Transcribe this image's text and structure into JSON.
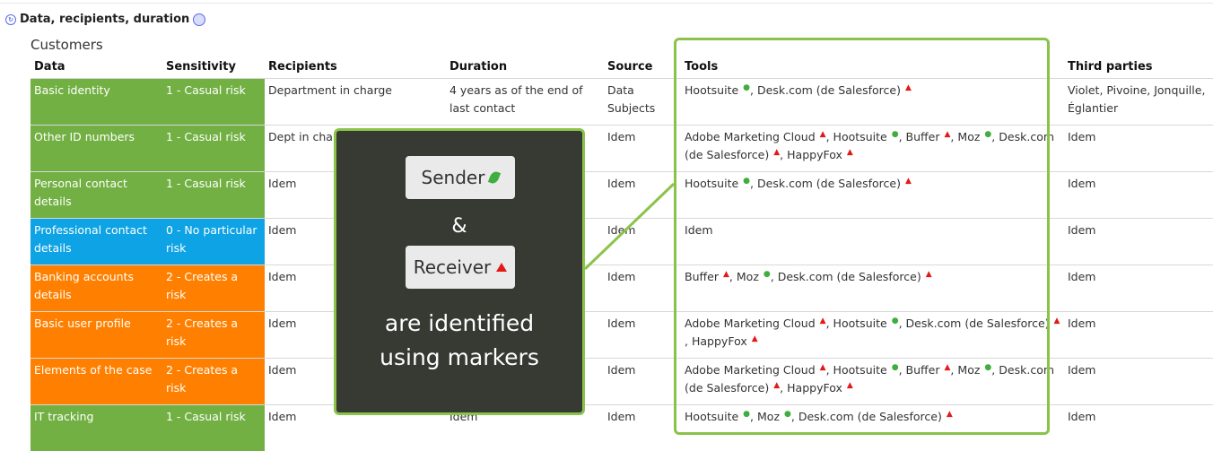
{
  "header": {
    "title": "Data, recipients, duration"
  },
  "group": {
    "title": "Customers"
  },
  "columns": {
    "data": "Data",
    "sensitivity": "Sensitivity",
    "recipients": "Recipients",
    "duration": "Duration",
    "source": "Source",
    "tools": "Tools",
    "third_parties": "Third parties"
  },
  "rows": [
    {
      "data": "Basic identity",
      "sensitivity": "1 - Casual risk",
      "recipients": "Department in charge",
      "duration": "4 years as of the end of last contact",
      "source": "Data Subjects",
      "tools": "Hootsuite ●, Desk.com (de Salesforce) ▲",
      "third_parties": "Violet, Pivoine, Jonquille, Églantier",
      "color": "#72b043"
    },
    {
      "data": "Other ID numbers",
      "sensitivity": "1 - Casual risk",
      "recipients": "Dept in charge, authorized ...",
      "duration": "",
      "source": "Idem",
      "tools": "Adobe Marketing Cloud ▲, Hootsuite ●, Buffer ▲, Moz ●, Desk.com (de Salesforce) ▲, HappyFox ▲",
      "third_parties": "Idem",
      "color": "#72b043"
    },
    {
      "data": "Personal contact details",
      "sensitivity": "1 - Casual risk",
      "recipients": "Idem",
      "duration": "",
      "source": "Idem",
      "tools": "Hootsuite ●, Desk.com (de Salesforce) ▲",
      "third_parties": "Idem",
      "color": "#72b043"
    },
    {
      "data": "Professional contact details",
      "sensitivity": "0 - No particular risk",
      "recipients": "Idem",
      "duration": "",
      "source": "Idem",
      "tools": "Idem",
      "third_parties": "Idem",
      "color": "#0ea3e4"
    },
    {
      "data": "Banking accounts details",
      "sensitivity": "2 - Creates a risk",
      "recipients": "Idem",
      "duration": "",
      "source": "Idem",
      "tools": "Buffer ▲, Moz ●, Desk.com (de Salesforce) ▲",
      "third_parties": "Idem",
      "color": "#ff8000"
    },
    {
      "data": "Basic user profile",
      "sensitivity": "2 - Creates a risk",
      "recipients": "Idem",
      "duration": "",
      "source": "Idem",
      "tools": "Adobe Marketing Cloud ▲, Hootsuite ●, Desk.com (de Salesforce) ▲, HappyFox ▲",
      "third_parties": "Idem",
      "color": "#ff8000"
    },
    {
      "data": "Elements of the case",
      "sensitivity": "2 - Creates a risk",
      "recipients": "Idem",
      "duration": "",
      "source": "Idem",
      "tools": "Adobe Marketing Cloud ▲, Hootsuite ●, Buffer ▲, Moz ●, Desk.com (de Salesforce) ▲, HappyFox ▲",
      "third_parties": "Idem",
      "color": "#ff8000"
    },
    {
      "data": "IT tracking",
      "sensitivity": "1 - Casual risk",
      "recipients": "Idem",
      "duration": "Idem",
      "source": "Idem",
      "tools": "Hootsuite ●, Moz ●, Desk.com (de Salesforce) ▲",
      "third_parties": "Idem",
      "color": "#72b043"
    }
  ],
  "overlay": {
    "sender_label": "Sender",
    "amp": "&",
    "receiver_label": "Receiver",
    "line1": "are identified",
    "line2": "using markers"
  },
  "colors": {
    "risk0": "#0ea3e4",
    "risk1": "#72b043",
    "risk2": "#ff8000",
    "accent": "#8bc34a",
    "sender_marker": "#3fae3f",
    "receiver_marker": "#e31919"
  },
  "icons": [
    "refresh-icon",
    "settings-icon",
    "leaf-marker-icon",
    "triangle-marker-icon"
  ]
}
